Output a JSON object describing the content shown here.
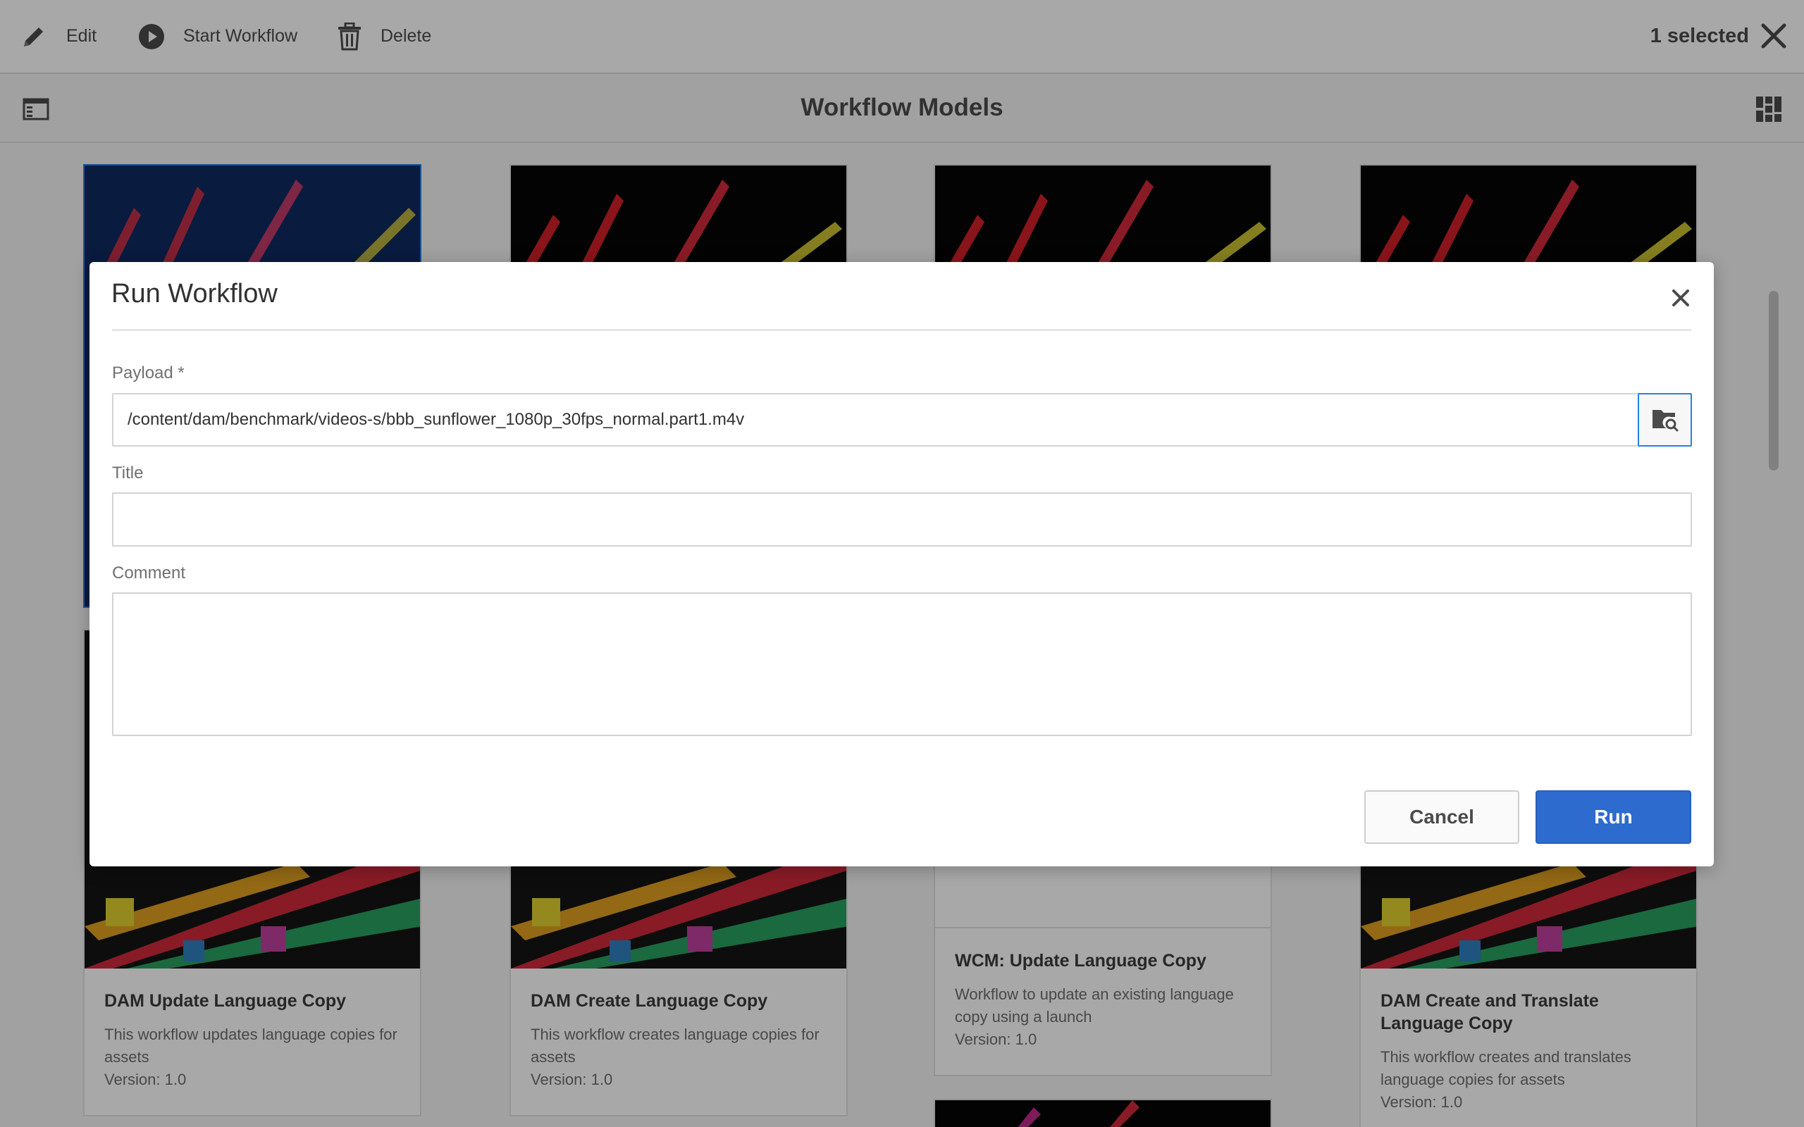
{
  "actionbar": {
    "edit_label": "Edit",
    "start_label": "Start Workflow",
    "delete_label": "Delete",
    "selected_text": "1 selected"
  },
  "header": {
    "title": "Workflow Models"
  },
  "cards": [
    {
      "name": "DAM Update Language Copy",
      "description": "This workflow updates language copies for assets",
      "version": "Version: 1.0"
    },
    {
      "name": "DAM Create Language Copy",
      "description": "This workflow creates language copies for assets",
      "version": "Version: 1.0"
    },
    {
      "name": "WCM: Update Language Copy",
      "description": "Workflow to update an existing language copy using a launch",
      "version": "Version: 1.0"
    },
    {
      "name": "DAM Create and Translate Language Copy",
      "description": "This workflow creates and translates language copies for assets",
      "version": "Version: 1.0"
    }
  ],
  "dialog": {
    "title": "Run Workflow",
    "payload_label": "Payload *",
    "payload_value": "/content/dam/benchmark/videos-s/bbb_sunflower_1080p_30fps_normal.part1.m4v",
    "title_label": "Title",
    "title_value": "",
    "comment_label": "Comment",
    "comment_value": "",
    "cancel_label": "Cancel",
    "run_label": "Run"
  },
  "colors": {
    "accent": "#2d6bcf",
    "focus": "#2680eb"
  },
  "icons": [
    "pencil-icon",
    "play-icon",
    "trash-icon",
    "close-icon",
    "rail-toggle-icon",
    "grid-view-icon",
    "folder-search-icon"
  ]
}
